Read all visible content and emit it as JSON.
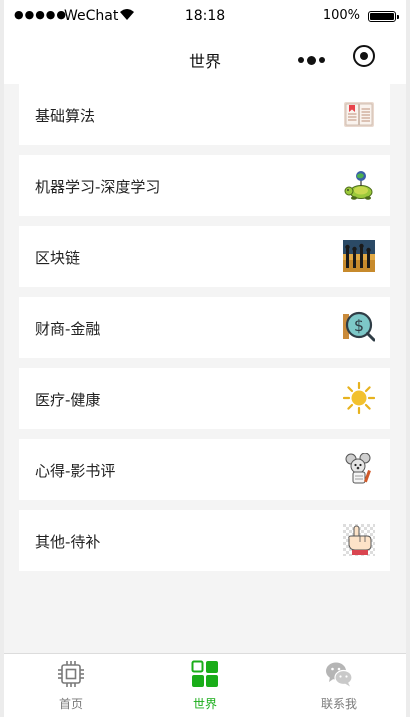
{
  "status_bar": {
    "signal": "●●●●●",
    "carrier": "WeChat",
    "time": "18:18",
    "battery": "100%",
    "battery_level": 1.0
  },
  "navbar": {
    "title": "世界"
  },
  "items": [
    {
      "label": "基础算法",
      "icon": "book-icon"
    },
    {
      "label": "机器学习-深度学习",
      "icon": "turtle-icon"
    },
    {
      "label": "区块链",
      "icon": "crowd-photo-icon"
    },
    {
      "label": "财商-金融",
      "icon": "dollar-magnifier-icon"
    },
    {
      "label": "医疗-健康",
      "icon": "sun-icon"
    },
    {
      "label": "心得-影书评",
      "icon": "mouse-character-icon"
    },
    {
      "label": "其他-待补",
      "icon": "pointing-hand-icon"
    }
  ],
  "tabbar": {
    "tabs": [
      {
        "label": "首页",
        "icon": "chip-icon",
        "active": false
      },
      {
        "label": "世界",
        "icon": "grid-icon",
        "active": true
      },
      {
        "label": "联系我",
        "icon": "wechat-icon",
        "active": false
      }
    ],
    "colors": {
      "active": "#1aad19",
      "inactive": "#7a7a7a"
    }
  }
}
